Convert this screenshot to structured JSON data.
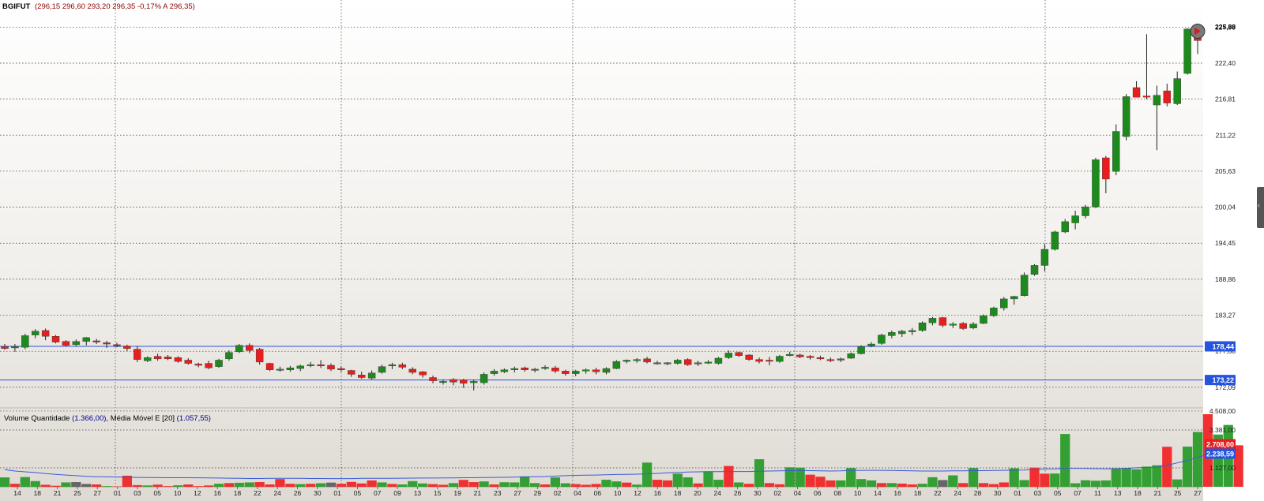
{
  "header": {
    "symbol": "BGIFUT",
    "quote": "(296,15  296,60  293,20  296,35  -0,17%  A 296,35)"
  },
  "volume_header": {
    "label": "Volume Quantidade",
    "value": "(1.366,00)",
    "ma_label": "Média Móvel E [20]",
    "ma_value": "(1.057,55)"
  },
  "price_axis": {
    "ticks": [
      "227,99",
      "222,40",
      "216,81",
      "211,22",
      "205,63",
      "200,04",
      "194,45",
      "188,86",
      "183,27",
      "177,68",
      "172,09"
    ],
    "last_price_label": "225,88",
    "hline_upper_label": "178,44",
    "hline_lower_label": "173,22"
  },
  "volume_axis": {
    "ticks": [
      "4.508,00",
      "3.381,00",
      "1.127,00"
    ],
    "last_volume_label": "2.708,00",
    "ma_label": "2.238,59"
  },
  "date_labels": [
    "14",
    "18",
    "21",
    "25",
    "27",
    "01",
    "03",
    "05",
    "10",
    "12",
    "16",
    "18",
    "22",
    "24",
    "26",
    "30",
    "01",
    "05",
    "07",
    "09",
    "13",
    "15",
    "19",
    "21",
    "23",
    "27",
    "29",
    "02",
    "04",
    "06",
    "10",
    "12",
    "16",
    "18",
    "20",
    "24",
    "26",
    "30",
    "02",
    "04",
    "06",
    "08",
    "10",
    "14",
    "16",
    "18",
    "22",
    "24",
    "28",
    "30",
    "01",
    "03",
    "05",
    "07",
    "11",
    "13",
    "18",
    "21",
    "25",
    "27"
  ],
  "colors": {
    "up": "#1e8a1e",
    "down": "#e81e1e",
    "neutral": "#666666",
    "hline": "#3050e0",
    "ma_line": "#3c5ad8",
    "header_symbol": "#000000",
    "header_quote": "#8b0000",
    "volume_label": "#000000",
    "volume_value": "#00008b"
  },
  "chart_data": {
    "type": "candlestick",
    "x_labels_are_dates": true,
    "y_range": [
      169.5,
      229.5
    ],
    "hlines": [
      178.44,
      173.22
    ],
    "ohlc": [
      [
        178.4,
        178.8,
        177.9,
        178.1
      ],
      [
        178.2,
        178.8,
        177.6,
        178.4
      ],
      [
        178.3,
        180.4,
        178.0,
        180.1
      ],
      [
        180.2,
        181.1,
        179.7,
        180.8
      ],
      [
        180.9,
        181.2,
        179.4,
        180.0
      ],
      [
        180.0,
        180.2,
        178.9,
        179.1
      ],
      [
        179.2,
        179.4,
        178.4,
        178.6
      ],
      [
        178.7,
        179.5,
        178.5,
        179.2
      ],
      [
        179.2,
        179.9,
        178.6,
        179.8
      ],
      [
        179.3,
        179.6,
        178.8,
        179.1
      ],
      [
        179.0,
        179.3,
        178.2,
        178.8
      ],
      [
        178.7,
        179.0,
        178.3,
        178.6
      ],
      [
        178.5,
        178.7,
        177.7,
        178.1
      ],
      [
        178.0,
        178.5,
        176.0,
        176.4
      ],
      [
        176.2,
        176.9,
        176.0,
        176.7
      ],
      [
        176.9,
        177.3,
        176.2,
        176.5
      ],
      [
        176.8,
        177.1,
        176.3,
        176.5
      ],
      [
        176.7,
        176.9,
        175.9,
        176.1
      ],
      [
        176.3,
        176.6,
        175.6,
        175.8
      ],
      [
        175.7,
        175.9,
        175.2,
        175.5
      ],
      [
        175.8,
        176.2,
        174.9,
        175.1
      ],
      [
        175.3,
        176.5,
        175.1,
        176.3
      ],
      [
        176.5,
        177.8,
        176.2,
        177.5
      ],
      [
        177.6,
        178.8,
        177.4,
        178.6
      ],
      [
        178.6,
        178.9,
        177.4,
        177.8
      ],
      [
        178.0,
        178.2,
        175.6,
        176.0
      ],
      [
        175.8,
        175.9,
        174.6,
        174.8
      ],
      [
        174.9,
        175.3,
        174.5,
        174.9
      ],
      [
        174.8,
        175.4,
        174.5,
        175.1
      ],
      [
        175.0,
        175.6,
        174.6,
        175.4
      ],
      [
        175.6,
        176.0,
        175.2,
        175.6
      ],
      [
        175.6,
        176.3,
        175.1,
        175.4
      ],
      [
        175.5,
        175.8,
        174.6,
        174.9
      ],
      [
        175.0,
        175.3,
        174.5,
        174.8
      ],
      [
        174.7,
        174.8,
        173.7,
        174.1
      ],
      [
        174.0,
        174.5,
        173.4,
        173.6
      ],
      [
        173.5,
        174.7,
        173.3,
        174.3
      ],
      [
        174.4,
        175.6,
        174.2,
        175.3
      ],
      [
        175.4,
        175.9,
        174.9,
        175.6
      ],
      [
        175.6,
        175.9,
        174.9,
        175.2
      ],
      [
        174.9,
        175.2,
        174.1,
        174.4
      ],
      [
        174.5,
        174.6,
        173.6,
        174.0
      ],
      [
        173.6,
        173.9,
        172.7,
        173.1
      ],
      [
        173.0,
        173.3,
        172.5,
        173.0
      ],
      [
        173.3,
        173.5,
        172.4,
        172.9
      ],
      [
        173.2,
        173.4,
        172.0,
        172.7
      ],
      [
        172.8,
        173.3,
        171.6,
        173.0
      ],
      [
        172.8,
        174.4,
        172.5,
        174.1
      ],
      [
        174.2,
        174.9,
        173.9,
        174.6
      ],
      [
        174.5,
        175.0,
        174.3,
        174.8
      ],
      [
        174.8,
        175.3,
        174.4,
        175.0
      ],
      [
        175.1,
        175.3,
        174.5,
        174.8
      ],
      [
        174.8,
        175.1,
        174.4,
        174.9
      ],
      [
        175.0,
        175.5,
        174.8,
        175.2
      ],
      [
        175.1,
        175.4,
        174.3,
        174.6
      ],
      [
        174.6,
        174.8,
        173.9,
        174.2
      ],
      [
        174.2,
        174.8,
        173.8,
        174.6
      ],
      [
        174.7,
        175.0,
        174.2,
        174.8
      ],
      [
        174.8,
        175.1,
        174.1,
        174.5
      ],
      [
        174.4,
        175.2,
        174.1,
        175.0
      ],
      [
        175.0,
        176.3,
        174.9,
        176.1
      ],
      [
        176.1,
        176.4,
        175.8,
        176.3
      ],
      [
        176.3,
        176.6,
        175.9,
        176.4
      ],
      [
        176.5,
        176.8,
        175.8,
        176.0
      ],
      [
        175.9,
        176.2,
        175.6,
        175.8
      ],
      [
        175.8,
        176.0,
        175.5,
        175.9
      ],
      [
        175.8,
        176.5,
        175.6,
        176.3
      ],
      [
        176.4,
        176.6,
        175.4,
        175.6
      ],
      [
        175.7,
        176.2,
        175.4,
        175.9
      ],
      [
        175.9,
        176.3,
        175.7,
        176.0
      ],
      [
        175.8,
        176.8,
        175.6,
        176.6
      ],
      [
        176.7,
        177.8,
        176.5,
        177.4
      ],
      [
        177.5,
        177.6,
        176.8,
        177.0
      ],
      [
        177.1,
        177.2,
        176.2,
        176.4
      ],
      [
        176.4,
        176.7,
        175.8,
        176.1
      ],
      [
        176.3,
        176.8,
        175.5,
        176.2
      ],
      [
        176.1,
        177.1,
        175.9,
        176.9
      ],
      [
        177.0,
        177.6,
        176.9,
        177.2
      ],
      [
        177.1,
        177.3,
        176.6,
        176.8
      ],
      [
        176.9,
        177.1,
        176.4,
        176.7
      ],
      [
        176.7,
        177.0,
        176.3,
        176.5
      ],
      [
        176.4,
        176.7,
        176.0,
        176.3
      ],
      [
        176.3,
        176.7,
        176.0,
        176.5
      ],
      [
        176.6,
        177.5,
        176.5,
        177.3
      ],
      [
        177.3,
        178.6,
        177.2,
        178.4
      ],
      [
        178.5,
        179.1,
        178.3,
        178.8
      ],
      [
        178.9,
        180.4,
        178.7,
        180.2
      ],
      [
        180.1,
        180.9,
        179.7,
        180.6
      ],
      [
        180.4,
        181.0,
        179.9,
        180.8
      ],
      [
        180.7,
        181.3,
        180.2,
        180.9
      ],
      [
        180.9,
        182.3,
        180.7,
        182.1
      ],
      [
        182.1,
        183.0,
        181.7,
        182.8
      ],
      [
        182.9,
        183.0,
        181.4,
        181.7
      ],
      [
        181.8,
        182.2,
        181.3,
        181.9
      ],
      [
        182.0,
        182.2,
        181.0,
        181.2
      ],
      [
        181.3,
        182.2,
        181.1,
        181.9
      ],
      [
        182.0,
        183.4,
        181.9,
        183.2
      ],
      [
        183.2,
        184.6,
        183.0,
        184.4
      ],
      [
        184.4,
        186.1,
        184.0,
        185.8
      ],
      [
        185.8,
        186.3,
        184.9,
        186.2
      ],
      [
        186.3,
        189.9,
        186.2,
        189.5
      ],
      [
        189.6,
        191.2,
        189.4,
        191.0
      ],
      [
        191.0,
        194.3,
        190.1,
        193.5
      ],
      [
        193.5,
        196.4,
        193.3,
        196.2
      ],
      [
        196.2,
        198.2,
        196.0,
        197.8
      ],
      [
        197.6,
        199.5,
        196.6,
        198.7
      ],
      [
        198.7,
        200.4,
        198.3,
        200.1
      ],
      [
        200.1,
        207.7,
        199.9,
        207.4
      ],
      [
        207.7,
        208.0,
        202.2,
        204.4
      ],
      [
        205.6,
        212.9,
        205.0,
        211.8
      ],
      [
        211.0,
        217.6,
        210.4,
        217.2
      ],
      [
        218.6,
        219.6,
        217.1,
        217.1
      ],
      [
        217.3,
        226.9,
        216.8,
        217.2
      ],
      [
        215.9,
        218.9,
        208.9,
        217.4
      ],
      [
        218.1,
        219.2,
        215.7,
        216.2
      ],
      [
        216.1,
        221.1,
        215.9,
        220.0
      ],
      [
        220.8,
        227.8,
        220.6,
        227.7
      ],
      [
        226.3,
        227.6,
        223.8,
        225.9
      ]
    ],
    "volume": [
      [
        560,
        "up"
      ],
      [
        180,
        "down"
      ],
      [
        580,
        "up"
      ],
      [
        340,
        "up"
      ],
      [
        120,
        "down"
      ],
      [
        60,
        "down"
      ],
      [
        260,
        "up"
      ],
      [
        280,
        "neutral"
      ],
      [
        170,
        "neutral"
      ],
      [
        140,
        "down"
      ],
      [
        40,
        "up"
      ],
      [
        20,
        "down"
      ],
      [
        660,
        "down"
      ],
      [
        100,
        "down"
      ],
      [
        80,
        "up"
      ],
      [
        130,
        "down"
      ],
      [
        40,
        "down"
      ],
      [
        90,
        "up"
      ],
      [
        140,
        "down"
      ],
      [
        40,
        "down"
      ],
      [
        80,
        "down"
      ],
      [
        180,
        "up"
      ],
      [
        220,
        "down"
      ],
      [
        240,
        "up"
      ],
      [
        260,
        "up"
      ],
      [
        280,
        "down"
      ],
      [
        140,
        "down"
      ],
      [
        460,
        "down"
      ],
      [
        180,
        "down"
      ],
      [
        160,
        "up"
      ],
      [
        180,
        "down"
      ],
      [
        210,
        "up"
      ],
      [
        250,
        "neutral"
      ],
      [
        180,
        "down"
      ],
      [
        290,
        "down"
      ],
      [
        200,
        "down"
      ],
      [
        380,
        "down"
      ],
      [
        260,
        "up"
      ],
      [
        170,
        "down"
      ],
      [
        140,
        "up"
      ],
      [
        340,
        "up"
      ],
      [
        200,
        "up"
      ],
      [
        160,
        "down"
      ],
      [
        120,
        "down"
      ],
      [
        220,
        "up"
      ],
      [
        410,
        "down"
      ],
      [
        280,
        "down"
      ],
      [
        320,
        "up"
      ],
      [
        140,
        "down"
      ],
      [
        270,
        "up"
      ],
      [
        260,
        "up"
      ],
      [
        620,
        "up"
      ],
      [
        220,
        "up"
      ],
      [
        140,
        "down"
      ],
      [
        560,
        "up"
      ],
      [
        210,
        "up"
      ],
      [
        160,
        "down"
      ],
      [
        120,
        "down"
      ],
      [
        170,
        "down"
      ],
      [
        420,
        "up"
      ],
      [
        320,
        "up"
      ],
      [
        250,
        "down"
      ],
      [
        130,
        "up"
      ],
      [
        1440,
        "up"
      ],
      [
        420,
        "down"
      ],
      [
        380,
        "down"
      ],
      [
        780,
        "up"
      ],
      [
        560,
        "up"
      ],
      [
        200,
        "down"
      ],
      [
        920,
        "up"
      ],
      [
        420,
        "up"
      ],
      [
        1240,
        "down"
      ],
      [
        260,
        "up"
      ],
      [
        180,
        "down"
      ],
      [
        1640,
        "up"
      ],
      [
        220,
        "down"
      ],
      [
        150,
        "down"
      ],
      [
        1160,
        "up"
      ],
      [
        1140,
        "up"
      ],
      [
        720,
        "down"
      ],
      [
        600,
        "down"
      ],
      [
        380,
        "down"
      ],
      [
        380,
        "up"
      ],
      [
        1120,
        "up"
      ],
      [
        460,
        "up"
      ],
      [
        380,
        "up"
      ],
      [
        220,
        "down"
      ],
      [
        220,
        "up"
      ],
      [
        190,
        "down"
      ],
      [
        140,
        "down"
      ],
      [
        180,
        "up"
      ],
      [
        570,
        "up"
      ],
      [
        400,
        "neutral"
      ],
      [
        680,
        "up"
      ],
      [
        220,
        "down"
      ],
      [
        1120,
        "up"
      ],
      [
        220,
        "down"
      ],
      [
        160,
        "down"
      ],
      [
        260,
        "down"
      ],
      [
        1100,
        "up"
      ],
      [
        400,
        "up"
      ],
      [
        1140,
        "down"
      ],
      [
        780,
        "down"
      ],
      [
        790,
        "up"
      ],
      [
        3140,
        "up"
      ],
      [
        210,
        "up"
      ],
      [
        390,
        "up"
      ],
      [
        360,
        "up"
      ],
      [
        380,
        "up"
      ],
      [
        1090,
        "up"
      ],
      [
        1120,
        "up"
      ],
      [
        1040,
        "up"
      ],
      [
        1200,
        "up"
      ],
      [
        1280,
        "up"
      ],
      [
        2380,
        "down"
      ],
      [
        440,
        "up"
      ],
      [
        2390,
        "up"
      ],
      [
        3260,
        "up"
      ],
      [
        4320,
        "down"
      ],
      [
        3110,
        "up"
      ],
      [
        3680,
        "up"
      ],
      [
        2470,
        "down"
      ]
    ],
    "volume_range": [
      0,
      4600
    ],
    "volume_ma": [
      1020,
      940,
      890,
      850,
      790,
      740,
      700,
      660,
      620,
      600,
      590,
      580,
      570,
      560,
      550,
      545,
      540,
      540,
      540,
      535,
      530,
      520,
      510,
      500,
      495,
      495,
      500,
      500,
      505,
      500,
      495,
      495,
      490,
      490,
      490,
      500,
      505,
      505,
      505,
      510,
      515,
      520,
      520,
      525,
      530,
      540,
      540,
      550,
      560,
      565,
      575,
      590,
      600,
      610,
      640,
      660,
      680,
      690,
      700,
      720,
      730,
      740,
      750,
      770,
      800,
      830,
      850,
      880,
      890,
      900,
      900,
      910,
      910,
      910,
      930,
      940,
      950,
      960,
      970,
      960,
      950,
      940,
      950,
      970,
      980,
      980,
      980,
      970,
      960,
      950,
      940,
      940,
      940,
      950,
      950,
      960,
      960,
      970,
      980,
      990,
      1000,
      1030,
      1060,
      1070,
      1100,
      1100,
      1090,
      1080,
      1070,
      1080,
      1100,
      1130,
      1150,
      1170,
      1280,
      1420,
      1560,
      1760,
      1910,
      2030,
      2150,
      2238
    ]
  }
}
